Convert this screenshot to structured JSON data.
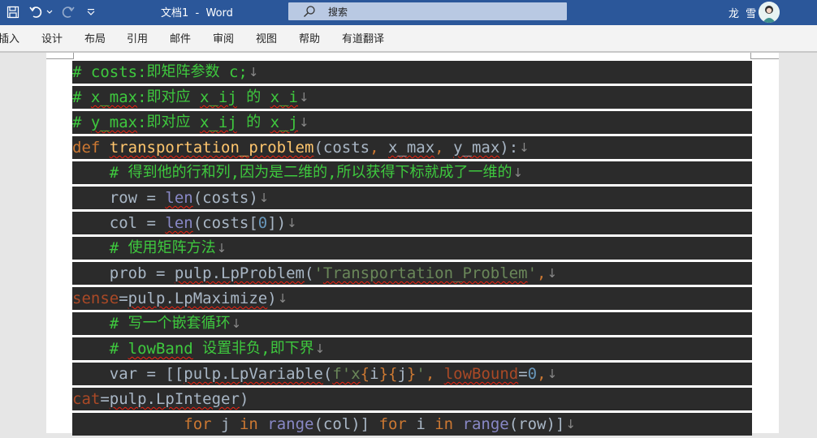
{
  "titlebar": {
    "doc_title": "文档1  -  Word",
    "search_placeholder": "搜索",
    "user_name": "龙 雪"
  },
  "colors": {
    "titlebar": "#2b579a",
    "code_bg": "#2b2b2b",
    "comment": "#3ec93e",
    "keyword": "#cc7832",
    "default": "#a9b7c6",
    "builtin": "#8888c6",
    "string": "#6a8759",
    "number": "#6897bb",
    "param": "#aa4926",
    "funcname": "#ffc66d"
  },
  "ribbon": {
    "tabs": [
      "插入",
      "设计",
      "布局",
      "引用",
      "邮件",
      "审阅",
      "视图",
      "帮助",
      "有道翻译"
    ]
  },
  "code": [
    [
      {
        "t": "# costs:",
        "c": "comment"
      },
      {
        "t": "即矩阵参数",
        "c": "comment",
        "cjk": true
      },
      {
        "t": " c;",
        "c": "comment"
      }
    ],
    [
      {
        "t": "# ",
        "c": "comment"
      },
      {
        "t": "x_max",
        "c": "comment",
        "sq": true
      },
      {
        "t": ":",
        "c": "comment"
      },
      {
        "t": "即对应",
        "c": "comment",
        "cjk": true
      },
      {
        "t": " ",
        "c": "comment"
      },
      {
        "t": "x_ij",
        "c": "comment",
        "sq": true
      },
      {
        "t": " ",
        "c": "comment"
      },
      {
        "t": "的",
        "c": "comment",
        "cjk": true
      },
      {
        "t": " ",
        "c": "comment"
      },
      {
        "t": "x_i",
        "c": "comment",
        "sq": true
      }
    ],
    [
      {
        "t": "# ",
        "c": "comment"
      },
      {
        "t": "y_max",
        "c": "comment",
        "sq": true
      },
      {
        "t": ":",
        "c": "comment"
      },
      {
        "t": "即对应",
        "c": "comment",
        "cjk": true
      },
      {
        "t": " ",
        "c": "comment"
      },
      {
        "t": "x_ij",
        "c": "comment",
        "sq": true
      },
      {
        "t": " ",
        "c": "comment"
      },
      {
        "t": "的",
        "c": "comment",
        "cjk": true
      },
      {
        "t": " ",
        "c": "comment"
      },
      {
        "t": "x_j",
        "c": "comment",
        "sq": true
      }
    ],
    [
      {
        "t": "def ",
        "c": "keyword"
      },
      {
        "t": "transportation_problem",
        "c": "funcname",
        "sq": true
      },
      {
        "t": "(costs",
        "c": "default"
      },
      {
        "t": ", ",
        "c": "keyword"
      },
      {
        "t": "x_max",
        "c": "default",
        "sq": true
      },
      {
        "t": ", ",
        "c": "keyword"
      },
      {
        "t": "y_max",
        "c": "default",
        "sq": true
      },
      {
        "t": "):",
        "c": "default"
      }
    ],
    [
      {
        "t": "    # ",
        "c": "comment"
      },
      {
        "t": "得到他的行和列",
        "c": "comment",
        "cjk": true
      },
      {
        "t": ",",
        "c": "comment"
      },
      {
        "t": "因为是二维的",
        "c": "comment",
        "cjk": true
      },
      {
        "t": ",",
        "c": "comment"
      },
      {
        "t": "所以获得下标就成了一维的",
        "c": "comment",
        "cjk": true
      }
    ],
    [
      {
        "t": "    row = ",
        "c": "default"
      },
      {
        "t": "len",
        "c": "builtin",
        "sq": true
      },
      {
        "t": "(costs)",
        "c": "default"
      }
    ],
    [
      {
        "t": "    col = ",
        "c": "default"
      },
      {
        "t": "len",
        "c": "builtin",
        "sq": true
      },
      {
        "t": "(costs[",
        "c": "default"
      },
      {
        "t": "0",
        "c": "number"
      },
      {
        "t": "])",
        "c": "default"
      }
    ],
    [
      {
        "t": "    # ",
        "c": "comment"
      },
      {
        "t": "使用矩阵方法",
        "c": "comment",
        "cjk": true
      }
    ],
    [
      {
        "t": "    prob = ",
        "c": "default"
      },
      {
        "t": "pulp.LpProblem",
        "c": "default",
        "sq": true
      },
      {
        "t": "(",
        "c": "default"
      },
      {
        "t": "'",
        "c": "string"
      },
      {
        "t": "Transportation_Problem",
        "c": "string",
        "sq": true
      },
      {
        "t": "'",
        "c": "string"
      },
      {
        "t": ",",
        "c": "keyword"
      }
    ],
    [
      {
        "t": "sense",
        "c": "param"
      },
      {
        "t": "=",
        "c": "default"
      },
      {
        "t": "pulp.LpMaximize",
        "c": "default",
        "sq": true
      },
      {
        "t": ")",
        "c": "default"
      }
    ],
    [
      {
        "t": "    # ",
        "c": "comment"
      },
      {
        "t": "写一个嵌套循环",
        "c": "comment",
        "cjk": true
      }
    ],
    [
      {
        "t": "    # ",
        "c": "comment"
      },
      {
        "t": "lowBand",
        "c": "comment",
        "sq": true
      },
      {
        "t": " ",
        "c": "comment"
      },
      {
        "t": "设置非负",
        "c": "comment",
        "cjk": true
      },
      {
        "t": ",",
        "c": "comment"
      },
      {
        "t": "即下界",
        "c": "comment",
        "cjk": true
      }
    ],
    [
      {
        "t": "    var = [[",
        "c": "default"
      },
      {
        "t": "pulp.LpVariable",
        "c": "default",
        "sq": true
      },
      {
        "t": "(",
        "c": "default"
      },
      {
        "t": "f'x",
        "c": "string",
        "sq": true
      },
      {
        "t": "{",
        "c": "keyword"
      },
      {
        "t": "i",
        "c": "default"
      },
      {
        "t": "}{",
        "c": "keyword"
      },
      {
        "t": "j",
        "c": "default"
      },
      {
        "t": "}",
        "c": "keyword"
      },
      {
        "t": "'",
        "c": "string"
      },
      {
        "t": ", ",
        "c": "keyword"
      },
      {
        "t": "lowBound",
        "c": "param",
        "sq": true
      },
      {
        "t": "=",
        "c": "default"
      },
      {
        "t": "0",
        "c": "number"
      },
      {
        "t": ",",
        "c": "keyword"
      }
    ],
    [
      {
        "t": "cat",
        "c": "param"
      },
      {
        "t": "=",
        "c": "default"
      },
      {
        "t": "pulp.LpInteger",
        "c": "default",
        "sq": true
      },
      {
        "t": ")",
        "c": "default"
      }
    ],
    [
      {
        "t": "            ",
        "c": "default"
      },
      {
        "t": "for ",
        "c": "keyword"
      },
      {
        "t": "j ",
        "c": "default"
      },
      {
        "t": "in ",
        "c": "keyword"
      },
      {
        "t": "range",
        "c": "builtin"
      },
      {
        "t": "(col)] ",
        "c": "default"
      },
      {
        "t": "for ",
        "c": "keyword"
      },
      {
        "t": "i ",
        "c": "default"
      },
      {
        "t": "in ",
        "c": "keyword"
      },
      {
        "t": "range",
        "c": "builtin"
      },
      {
        "t": "(row)]",
        "c": "default"
      }
    ]
  ],
  "pilcrow": "↓"
}
